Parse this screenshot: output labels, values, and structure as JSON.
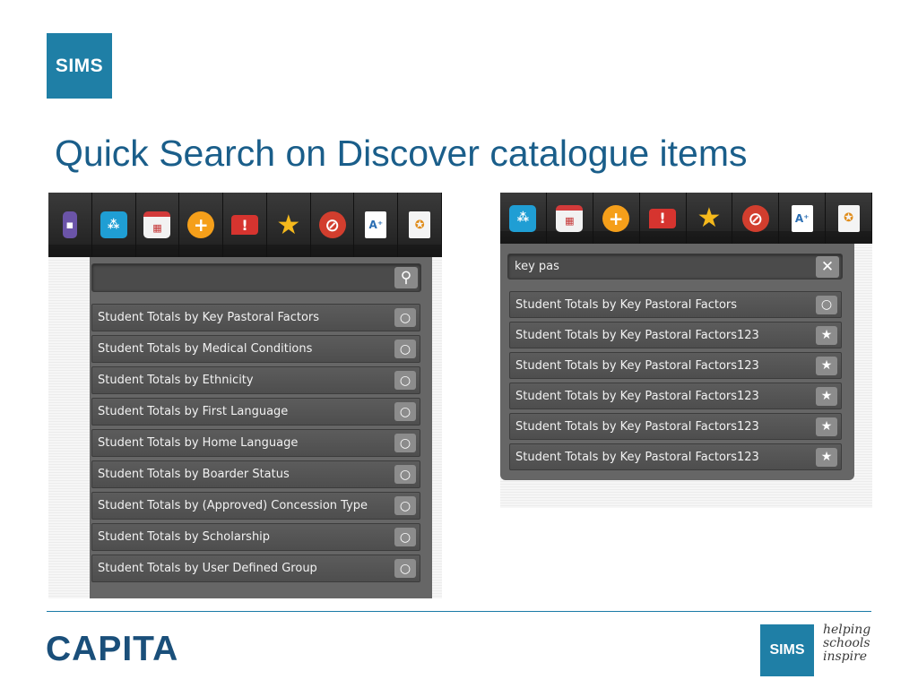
{
  "brand": {
    "logo_text": "SIMS",
    "company": "CAPITA",
    "tagline": [
      "helping",
      "schools",
      "inspire"
    ]
  },
  "slide": {
    "title": "Quick Search on Discover catalogue items"
  },
  "left_panel": {
    "toolbar": [
      {
        "name": "people-icon",
        "glyph": "▪"
      },
      {
        "name": "group-icon",
        "glyph": "⁂"
      },
      {
        "name": "calendar-icon",
        "glyph": "▦"
      },
      {
        "name": "add-icon",
        "glyph": "+"
      },
      {
        "name": "alert-icon",
        "glyph": "!"
      },
      {
        "name": "star-icon",
        "glyph": "★"
      },
      {
        "name": "no-entry-icon",
        "glyph": "⊘"
      },
      {
        "name": "document-icon",
        "glyph": "A⁺"
      },
      {
        "name": "certificate-icon",
        "glyph": "✪"
      }
    ],
    "search": {
      "value": "",
      "placeholder": ""
    },
    "results": [
      {
        "label": "Student Totals by Key Pastoral Factors",
        "icon": "○"
      },
      {
        "label": "Student Totals by Medical Conditions",
        "icon": "○"
      },
      {
        "label": "Student Totals by Ethnicity",
        "icon": "○"
      },
      {
        "label": "Student Totals by First Language",
        "icon": "○"
      },
      {
        "label": "Student Totals by Home Language",
        "icon": "○"
      },
      {
        "label": "Student Totals by Boarder Status",
        "icon": "○"
      },
      {
        "label": "Student Totals by (Approved) Concession Type",
        "icon": "○"
      },
      {
        "label": "Student Totals by Scholarship",
        "icon": "○"
      },
      {
        "label": "Student Totals by User Defined Group",
        "icon": "○"
      }
    ]
  },
  "right_panel": {
    "toolbar": [
      {
        "name": "group-icon",
        "glyph": "⁂"
      },
      {
        "name": "calendar-icon",
        "glyph": "▦"
      },
      {
        "name": "add-icon",
        "glyph": "+"
      },
      {
        "name": "alert-icon",
        "glyph": "!"
      },
      {
        "name": "star-icon",
        "glyph": "★"
      },
      {
        "name": "no-entry-icon",
        "glyph": "⊘"
      },
      {
        "name": "document-icon",
        "glyph": "A⁺"
      },
      {
        "name": "certificate-icon",
        "glyph": "✪"
      }
    ],
    "search": {
      "value": "key pas"
    },
    "results": [
      {
        "label": "Student Totals by Key Pastoral Factors",
        "icon": "○"
      },
      {
        "label": "Student Totals by Key Pastoral Factors123",
        "icon": "★"
      },
      {
        "label": "Student Totals by Key Pastoral Factors123",
        "icon": "★"
      },
      {
        "label": "Student Totals by Key Pastoral Factors123",
        "icon": "★"
      },
      {
        "label": "Student Totals by Key Pastoral Factors123",
        "icon": "★"
      },
      {
        "label": "Student Totals by Key Pastoral Factors123",
        "icon": "★"
      }
    ]
  }
}
